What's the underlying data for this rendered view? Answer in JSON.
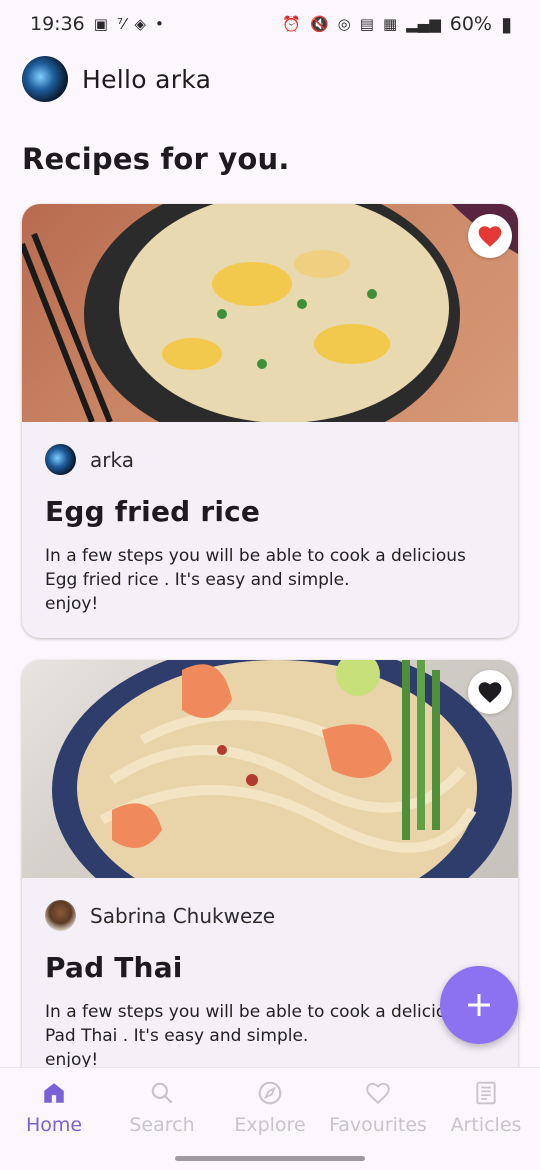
{
  "status_bar": {
    "time": "19:36",
    "battery": "60%"
  },
  "header": {
    "greeting": "Hello arka"
  },
  "section_title": "Recipes for you.",
  "recipes": [
    {
      "author": "arka",
      "title": "Egg fried rice",
      "description": "In a few steps you will be able to cook a delicious\nEgg fried rice . It's easy and simple.\nenjoy!",
      "favourited": true,
      "heart_color": "#e53935"
    },
    {
      "author": "Sabrina Chukweze",
      "title": "Pad Thai",
      "description": "In a few steps you will be able to cook a delicious\nPad Thai . It's easy and simple.\nenjoy!",
      "favourited": false,
      "heart_color": "#1d1b20"
    }
  ],
  "fab": {
    "icon": "plus-icon"
  },
  "bottom_nav": [
    {
      "label": "Home",
      "icon": "home-icon",
      "active": true
    },
    {
      "label": "Search",
      "icon": "search-icon",
      "active": false
    },
    {
      "label": "Explore",
      "icon": "compass-icon",
      "active": false
    },
    {
      "label": "Favourites",
      "icon": "heart-icon",
      "active": false
    },
    {
      "label": "Articles",
      "icon": "article-icon",
      "active": false
    }
  ],
  "colors": {
    "accent": "#7b61d6",
    "fab": "#8c72f0",
    "inactive_nav": "#c9c3cc"
  }
}
